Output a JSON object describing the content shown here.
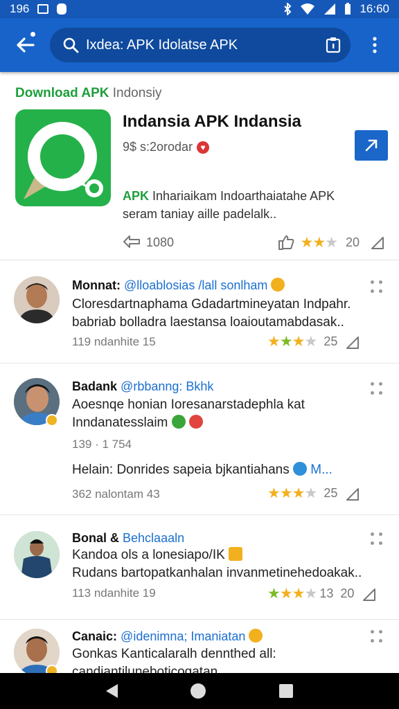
{
  "status_bar": {
    "left_number": "196",
    "time": "16:60"
  },
  "search": {
    "query": "Ixdea: APK Idolatse APK"
  },
  "app_card": {
    "heading_green": "Download APK",
    "heading_grey": "Indonsiy",
    "title": "Indansia APK Indansia",
    "subtitle": "9$ s:2orodar",
    "desc_green": "APK",
    "desc_line1": " Inhariaikam Indoarthaiatahe APK",
    "desc_line2": "seram taniay aille padelalk..",
    "like_count": "1080",
    "rating": "20",
    "accent": "#1a66c9",
    "logo_color": "#25b14a"
  },
  "reviews": [
    {
      "name": "Monnat:",
      "handle": "@lloablosias /lall sonlham",
      "line1": "Cloresdartnaphama Gdadartmineyatan Indpahr.",
      "line2": "babriab bolladra laestansa loaioutamabdasak..",
      "meta": "119 ndanhite   15",
      "rating": "25"
    },
    {
      "name": "Badank",
      "handle": "@rbbanng: Bkhk",
      "line1": "Aoesnqe honian Ioresanarstadephla kat",
      "line2": "Inndanatesslaim",
      "time": "139 · 1 754",
      "reply_label": "Helain:",
      "reply_text": "Donrides sapeia bjkantiahans",
      "reply_handle": "M...",
      "meta": "362 nalontam  43",
      "rating": "25"
    },
    {
      "name": "Bonal &",
      "handle": "Behclaaaln",
      "line1": "Kandoa ols a lonesiapo/IK",
      "line2": "Rudans bartopatkanhalan invanmetinehedoakak..",
      "meta": "113 ndanhite   19",
      "extra": "13",
      "rating": "20"
    },
    {
      "name": "Canaic:",
      "handle": "@idenimna;  Imaniatan",
      "line1": "Gonkas Kanticalaralh dennthed all:",
      "line2": "candiantiluneboticogatan"
    }
  ]
}
